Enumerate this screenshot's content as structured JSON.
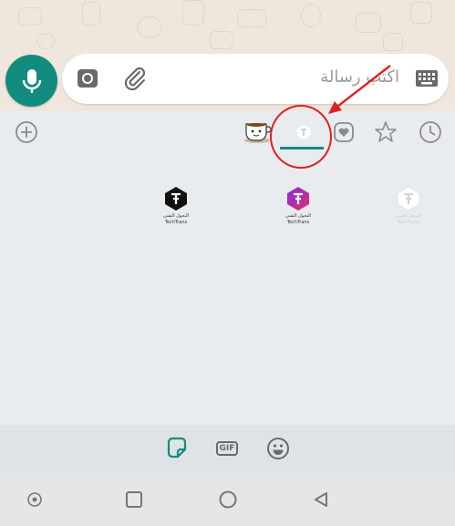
{
  "composer": {
    "placeholder": "اكتب رسالة"
  },
  "icons": {
    "mic": "mic-icon",
    "camera": "camera-icon",
    "attach": "paperclip-icon",
    "keyboard": "keyboard-icon",
    "add": "plus-circle-icon",
    "recent": "clock-icon",
    "favorites": "star-icon",
    "heart": "heart-icon",
    "sticker": "sticker-icon",
    "emoji": "emoji-icon"
  },
  "sticker_tabs": {
    "gif_label": "GIF"
  },
  "stickers": [
    {
      "caption_ar": "التحول التقني",
      "caption_en": "TechTrans"
    },
    {
      "caption_ar": "التحول التقني",
      "caption_en": "TechTrans"
    },
    {
      "caption_ar": "التحول التقني",
      "caption_en": "TechTrans"
    }
  ],
  "colors": {
    "accent": "#128c7e",
    "annotation": "#e02020",
    "chat_background": "#efe7de",
    "panel_background": "#e9ecef"
  }
}
